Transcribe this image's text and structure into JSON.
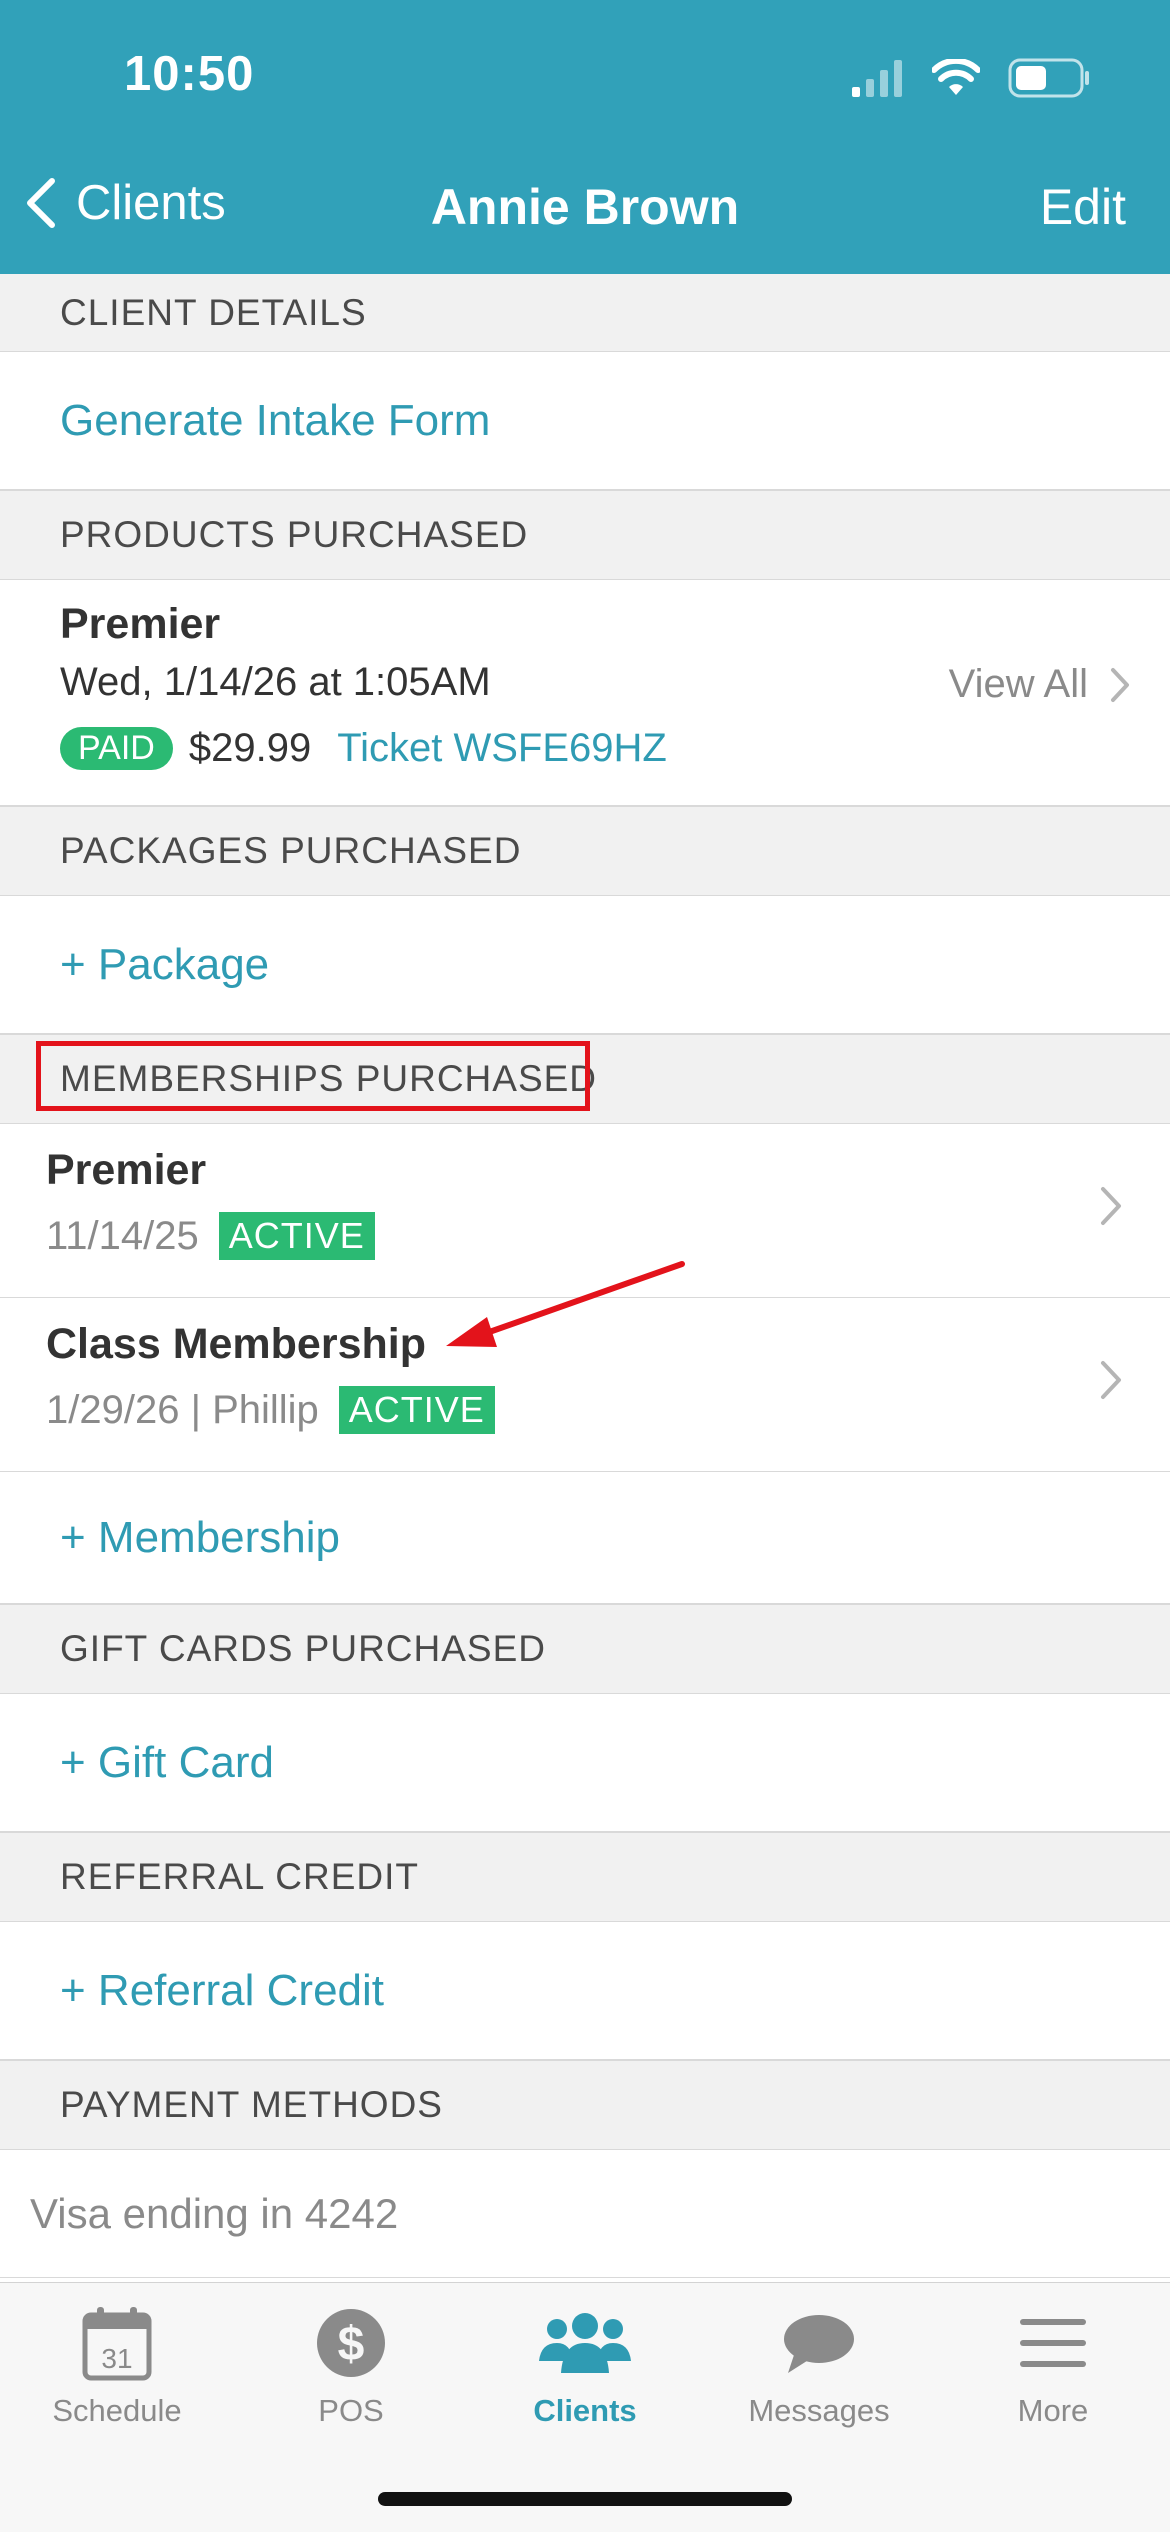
{
  "status_bar": {
    "time": "10:50"
  },
  "nav": {
    "back_label": "Clients",
    "title": "Annie Brown",
    "edit_label": "Edit"
  },
  "client_details": {
    "header": "CLIENT DETAILS",
    "generate_intake": "Generate Intake Form"
  },
  "products": {
    "header": "PRODUCTS PURCHASED",
    "item": {
      "name": "Premier",
      "date": "Wed, 1/14/26 at 1:05AM",
      "status": "PAID",
      "price": "$29.99",
      "ticket": "Ticket WSFE69HZ"
    },
    "view_all": "View All"
  },
  "packages": {
    "header": "PACKAGES PURCHASED",
    "add_label": "+ Package"
  },
  "memberships": {
    "header": "MEMBERSHIPS PURCHASED",
    "items": [
      {
        "name": "Premier",
        "sub": "11/14/25",
        "status": "ACTIVE"
      },
      {
        "name": "Class Membership",
        "sub": "1/29/26 | Phillip",
        "status": "ACTIVE"
      }
    ],
    "add_label": "+ Membership"
  },
  "gift_cards": {
    "header": "GIFT CARDS PURCHASED",
    "add_label": "+ Gift Card"
  },
  "referral": {
    "header": "REFERRAL CREDIT",
    "add_label": "+ Referral Credit"
  },
  "payment_methods": {
    "header": "PAYMENT METHODS",
    "item": "Visa ending in 4242"
  },
  "tabs": [
    {
      "label": "Schedule",
      "icon": "calendar-icon",
      "calendar_day": "31"
    },
    {
      "label": "POS",
      "icon": "dollar-icon"
    },
    {
      "label": "Clients",
      "icon": "people-icon",
      "active": true
    },
    {
      "label": "Messages",
      "icon": "chat-bubble-icon"
    },
    {
      "label": "More",
      "icon": "hamburger-menu-icon"
    }
  ],
  "colors": {
    "brand": "#31a1b9",
    "link": "#2f9bb3",
    "status_green": "#2bba73",
    "annotation_red": "#e3131b"
  }
}
